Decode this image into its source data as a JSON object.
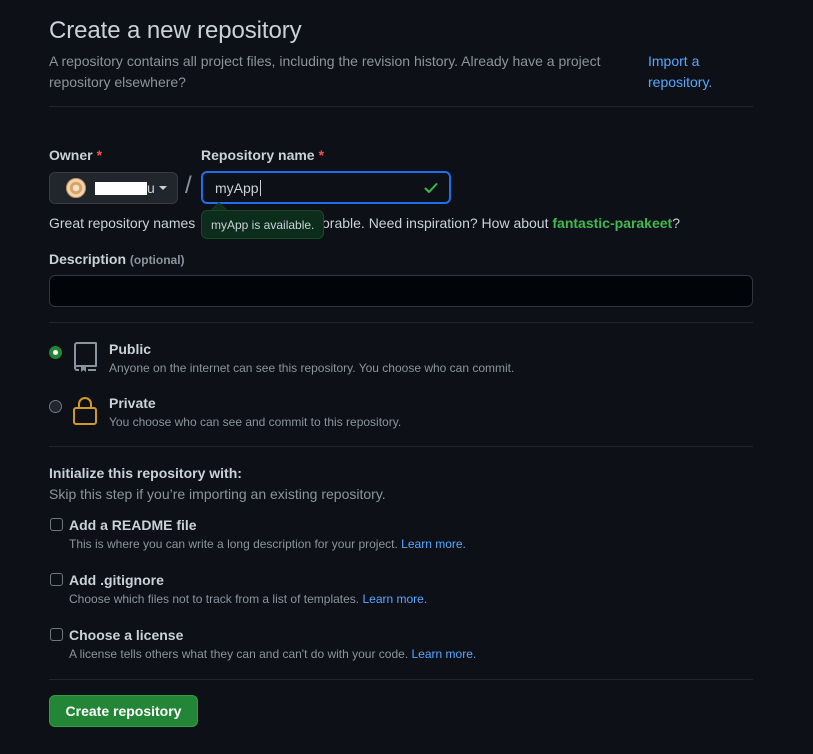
{
  "header": {
    "title": "Create a new repository",
    "description": "A repository contains all project files, including the revision history. Already have a project repository elsewhere?",
    "import_link": "Import a repository."
  },
  "owner": {
    "label": "Owner",
    "required_marker": "*",
    "username_suffix": "u"
  },
  "repo_name": {
    "label": "Repository name",
    "required_marker": "*",
    "value": "myApp",
    "availability_tooltip": "myApp is available."
  },
  "hint": {
    "prefix": "Great repository names",
    "middle": "orable. Need inspiration? How about",
    "suggestion": "fantastic-parakeet",
    "suffix": "?"
  },
  "description": {
    "label": "Description",
    "optional": "(optional)",
    "value": ""
  },
  "visibility": {
    "options": [
      {
        "title": "Public",
        "description": "Anyone on the internet can see this repository. You choose who can commit.",
        "selected": true,
        "icon": "repo-icon"
      },
      {
        "title": "Private",
        "description": "You choose who can see and commit to this repository.",
        "selected": false,
        "icon": "lock-icon"
      }
    ]
  },
  "initialize": {
    "title": "Initialize this repository with:",
    "subtitle": "Skip this step if you’re importing an existing repository.",
    "options": [
      {
        "title": "Add a README file",
        "description": "This is where you can write a long description for your project.",
        "link": "Learn more.",
        "checked": false
      },
      {
        "title": "Add .gitignore",
        "description": "Choose which files not to track from a list of templates.",
        "link": "Learn more.",
        "checked": false
      },
      {
        "title": "Choose a license",
        "description": "A license tells others what they can and can't do with your code.",
        "link": "Learn more.",
        "checked": false
      }
    ]
  },
  "submit": {
    "label": "Create repository"
  },
  "colors": {
    "background": "#0d1117",
    "accent_green": "#238636",
    "link_blue": "#58a6ff",
    "focus_blue": "#1f6feb",
    "required_red": "#f85149",
    "lock_orange": "#d29922"
  }
}
